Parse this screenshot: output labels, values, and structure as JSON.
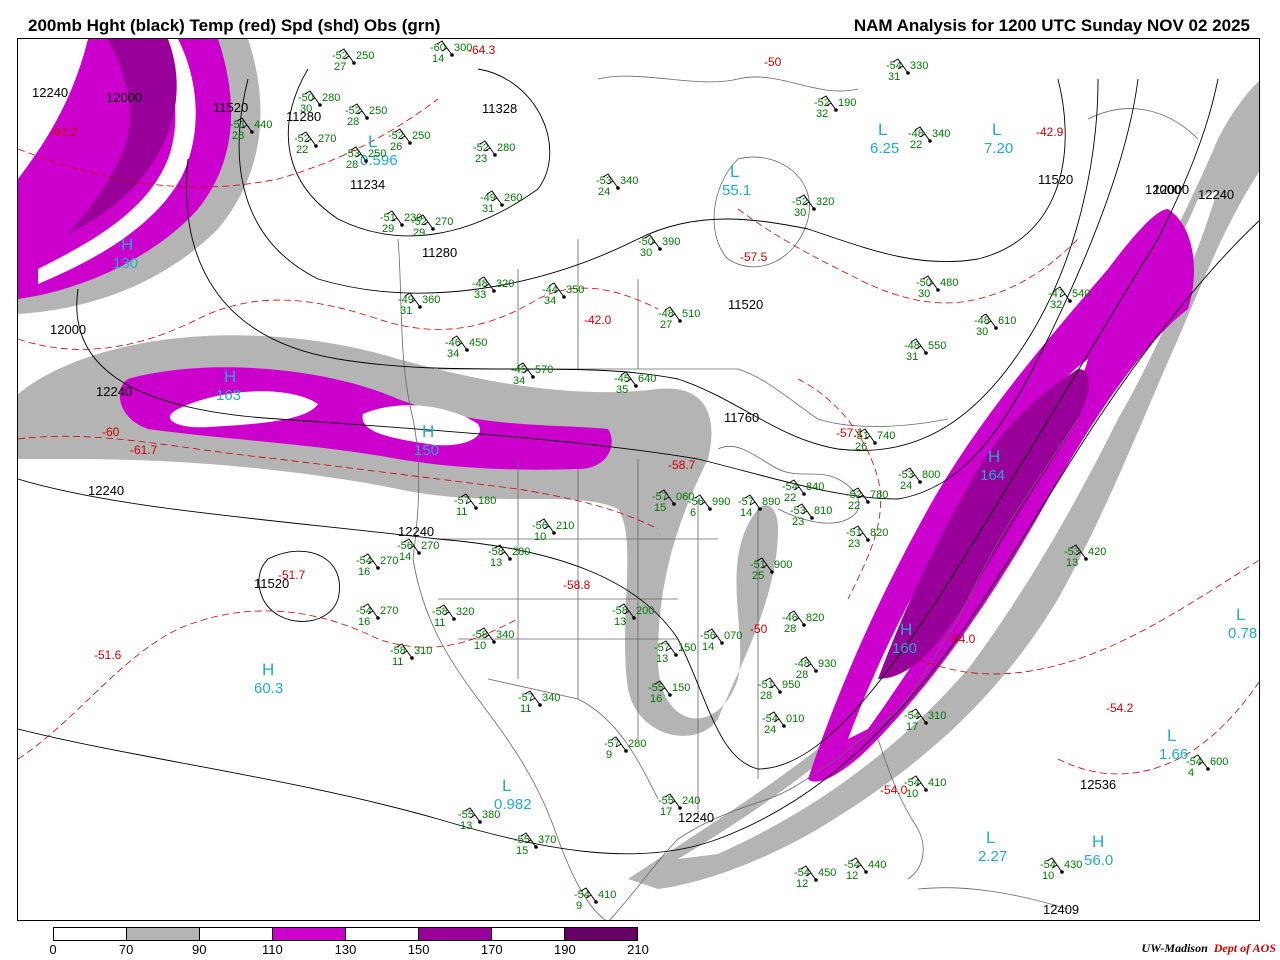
{
  "header": {
    "left_title": "200mb Hght (black) Temp (red) Spd (shd) Obs (grn)",
    "right_title": "NAM Analysis for 1200 UTC Sunday  NOV 02 2025"
  },
  "legend": {
    "labels": [
      "0",
      "70",
      "90",
      "110",
      "130",
      "150",
      "170",
      "190",
      "210"
    ],
    "colors": [
      "#ffffff",
      "#b4b4b4",
      "#ffffff",
      "#cc00cc",
      "#ffffff",
      "#990099",
      "#ffffff",
      "#660066"
    ]
  },
  "credit": {
    "org": "UW-Madison",
    "dept": "Dept of AOS"
  },
  "colors": {
    "height": "#000000",
    "temp": "#cc0000",
    "obs": "#007700",
    "center": "#22aacc",
    "speed_70": "#b4b4b4",
    "speed_110": "#cc00cc",
    "speed_150": "#990099"
  },
  "height_labels": [
    "12240",
    "12000",
    "11520",
    "11280",
    "11234",
    "11328",
    "11280",
    "12000",
    "12000",
    "12240",
    "12240",
    "12240",
    "11520",
    "11760",
    "11520",
    "12000",
    "11520",
    "12240",
    "12240",
    "12536",
    "12409"
  ],
  "temp_labels": [
    "-60.2",
    "-64.3",
    "-50",
    "-42.9",
    "-57.5",
    "-42.0",
    "-57.1",
    "-58.7",
    "-58.8",
    "-51.6",
    "-51.7",
    "-54.0",
    "-54.0",
    "-54.2",
    "-50",
    "-60",
    "-61.7"
  ],
  "centers": [
    {
      "letter": "H",
      "value": "130",
      "kind": "max"
    },
    {
      "letter": "H",
      "value": "163",
      "kind": "max"
    },
    {
      "letter": "H",
      "value": "150",
      "kind": "max"
    },
    {
      "letter": "H",
      "value": "164",
      "kind": "max"
    },
    {
      "letter": "H",
      "value": "160",
      "kind": "max"
    },
    {
      "letter": "H",
      "value": "60.3",
      "kind": "max"
    },
    {
      "letter": "H",
      "value": "56.0",
      "kind": "max"
    },
    {
      "letter": "L",
      "value": "6.25",
      "kind": "min"
    },
    {
      "letter": "L",
      "value": "7.20",
      "kind": "min"
    },
    {
      "letter": "L",
      "value": "0.596",
      "kind": "min"
    },
    {
      "letter": "L",
      "value": "0.78",
      "kind": "min"
    },
    {
      "letter": "L",
      "value": "1.66",
      "kind": "min"
    },
    {
      "letter": "L",
      "value": "2.27",
      "kind": "min"
    },
    {
      "letter": "L",
      "value": "0.982",
      "kind": "min"
    },
    {
      "letter": "L",
      "value": "55.1",
      "kind": "min"
    }
  ],
  "obs": [
    {
      "t": "-52",
      "h": "250",
      "d": "27"
    },
    {
      "t": "-60",
      "h": "300",
      "d": "14"
    },
    {
      "t": "-50",
      "h": "280",
      "d": "30"
    },
    {
      "t": "-52",
      "h": "250",
      "d": "28"
    },
    {
      "t": "-51",
      "h": "440",
      "d": "28"
    },
    {
      "t": "-52",
      "h": "270",
      "d": "22"
    },
    {
      "t": "-52",
      "h": "250",
      "d": "26"
    },
    {
      "t": "-53",
      "h": "250",
      "d": "28"
    },
    {
      "t": "-52",
      "h": "280",
      "d": "23"
    },
    {
      "t": "-53",
      "h": "340",
      "d": "24"
    },
    {
      "t": "-49",
      "h": "260",
      "d": "31"
    },
    {
      "t": "-51",
      "h": "230",
      "d": "29"
    },
    {
      "t": "-52",
      "h": "270",
      "d": "29"
    },
    {
      "t": "-50",
      "h": "390",
      "d": "30"
    },
    {
      "t": "-54",
      "h": "330",
      "d": "31"
    },
    {
      "t": "-52",
      "h": "190",
      "d": "32"
    },
    {
      "t": "-48",
      "h": "340",
      "d": "22"
    },
    {
      "t": "-52",
      "h": "320",
      "d": "30"
    },
    {
      "t": "-48",
      "h": "320",
      "d": "33"
    },
    {
      "t": "-44",
      "h": "350",
      "d": "34"
    },
    {
      "t": "-49",
      "h": "360",
      "d": "31"
    },
    {
      "t": "-48",
      "h": "510",
      "d": "27"
    },
    {
      "t": "-50",
      "h": "480",
      "d": "30"
    },
    {
      "t": "-47",
      "h": "540",
      "d": "32"
    },
    {
      "t": "-48",
      "h": "610",
      "d": "30"
    },
    {
      "t": "-48",
      "h": "550",
      "d": "31"
    },
    {
      "t": "-46",
      "h": "450",
      "d": "34"
    },
    {
      "t": "-45",
      "h": "570",
      "d": "34"
    },
    {
      "t": "-45",
      "h": "640",
      "d": "35"
    },
    {
      "t": "-51",
      "h": "740",
      "d": "26"
    },
    {
      "t": "-57",
      "h": "180",
      "d": "11"
    },
    {
      "t": "-56",
      "h": "210",
      "d": "10"
    },
    {
      "t": "-58",
      "h": "280",
      "d": "13"
    },
    {
      "t": "-56",
      "h": "270",
      "d": "14"
    },
    {
      "t": "-54",
      "h": "270",
      "d": "16"
    },
    {
      "t": "-54",
      "h": "270",
      "d": "16"
    },
    {
      "t": "-58",
      "h": "320",
      "d": "11"
    },
    {
      "t": "-58",
      "h": "340",
      "d": "10"
    },
    {
      "t": "-58",
      "h": "310",
      "d": "11"
    },
    {
      "t": "-57",
      "h": "340",
      "d": "11"
    },
    {
      "t": "-57",
      "h": "280",
      "d": "9"
    },
    {
      "t": "-58",
      "h": "200",
      "d": "13"
    },
    {
      "t": "-57",
      "h": "150",
      "d": "13"
    },
    {
      "t": "-55",
      "h": "150",
      "d": "16"
    },
    {
      "t": "-56",
      "h": "070",
      "d": "14"
    },
    {
      "t": "-57",
      "h": "060",
      "d": "15"
    },
    {
      "t": "-56",
      "h": "990",
      "d": "6"
    },
    {
      "t": "-57",
      "h": "890",
      "d": "14"
    },
    {
      "t": "-54",
      "h": "840",
      "d": "22"
    },
    {
      "t": "-53",
      "h": "810",
      "d": "23"
    },
    {
      "t": "-52",
      "h": "780",
      "d": "22"
    },
    {
      "t": "-51",
      "h": "820",
      "d": "23"
    },
    {
      "t": "-53",
      "h": "800",
      "d": "24"
    },
    {
      "t": "-51",
      "h": "900",
      "d": "25"
    },
    {
      "t": "-46",
      "h": "820",
      "d": "28"
    },
    {
      "t": "-48",
      "h": "930",
      "d": "28"
    },
    {
      "t": "-51",
      "h": "950",
      "d": "28"
    },
    {
      "t": "-54",
      "h": "010",
      "d": "24"
    },
    {
      "t": "-54",
      "h": "310",
      "d": "17"
    },
    {
      "t": "-54",
      "h": "410",
      "d": "10"
    },
    {
      "t": "-53",
      "h": "420",
      "d": "13"
    },
    {
      "t": "-54",
      "h": "430",
      "d": "10"
    },
    {
      "t": "-54",
      "h": "440",
      "d": "12"
    },
    {
      "t": "-54",
      "h": "450",
      "d": "12"
    },
    {
      "t": "-54",
      "h": "410",
      "d": "9"
    },
    {
      "t": "-55",
      "h": "380",
      "d": "13"
    },
    {
      "t": "-55",
      "h": "370",
      "d": "15"
    },
    {
      "t": "-55",
      "h": "240",
      "d": "17"
    },
    {
      "t": "-54",
      "h": "600",
      "d": "4"
    }
  ]
}
